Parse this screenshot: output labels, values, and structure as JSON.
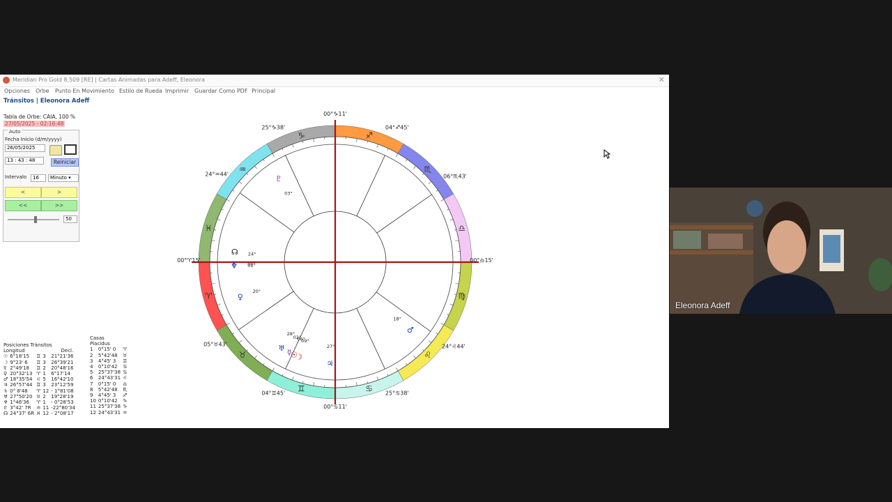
{
  "window": {
    "title": "Meridian Pro Gold 8.509 [RE] | Cartas Animadas para Adeff, Eleonora",
    "close_glyph": "✕"
  },
  "menu": [
    "Opciones",
    "Orbe",
    "Punto En Movimiento",
    "Estilo de Rueda",
    "Imprimir",
    "Guardar Como PDF",
    "Principal"
  ],
  "header": {
    "title": "Tránsitos | Eleonora Adeff",
    "orb_table": "Tabla de Orbe: CAIA, 100 %",
    "datetime": "27/05/2025 - 02:16:48"
  },
  "controls": {
    "auto_label": "Auto",
    "start_label": "Fecha Inicio (d/m/yyyy)",
    "start_date": "26/05/2025",
    "start_time": "13 : 43 : 48",
    "reset_label": "Reiniciar",
    "interval_label": "Intervalo",
    "interval_value": "16",
    "interval_unit": "Minuto",
    "prev_label": "<",
    "next_label": ">",
    "fast_prev_label": "<<",
    "fast_next_label": ">>",
    "slider_value": "50"
  },
  "positions": {
    "title": "Posiciones Tránsitos",
    "col_long": "Longitud",
    "col_decl": "Decl.",
    "rows": [
      {
        "glyph": "☉",
        "long": "6°18'15",
        "sign": "♊",
        "house": "3",
        "decl": "21°21'36"
      },
      {
        "glyph": "☽",
        "long": "9°23' 6",
        "sign": "♊",
        "house": "3",
        "decl": "26°39'21"
      },
      {
        "glyph": "☿",
        "long": "2°49'18",
        "sign": "♊",
        "house": "2",
        "decl": "20°48'16"
      },
      {
        "glyph": "♀",
        "long": "20°32'13",
        "sign": "♈",
        "house": "1",
        "decl": "6°17'14"
      },
      {
        "glyph": "♂",
        "long": "18°35'54",
        "sign": "♌",
        "house": "5",
        "decl": "16°42'10"
      },
      {
        "glyph": "♃",
        "long": "26°57'44",
        "sign": "♊",
        "house": "3",
        "decl": "23°12'59"
      },
      {
        "glyph": "♄",
        "long": "0° 8'48",
        "sign": "♈",
        "house": "12",
        "decl": "- 1°81'08"
      },
      {
        "glyph": "♅",
        "long": "27°50'20",
        "sign": "♉",
        "house": "2",
        "decl": "19°28'19"
      },
      {
        "glyph": "♆",
        "long": "1°46'36",
        "sign": "♈",
        "house": "1",
        "decl": "- 0°28'53"
      },
      {
        "glyph": "♇",
        "long": "3°42' 7R",
        "sign": "♒",
        "house": "11",
        "decl": "-22°80'34"
      },
      {
        "glyph": "☊",
        "long": "24°37' 6R",
        "sign": "♓",
        "house": "12",
        "decl": "- 2°08'17"
      }
    ]
  },
  "houses": {
    "title": "Casas",
    "subtitle": "Placidus",
    "rows": [
      {
        "n": "1",
        "pos": "0°15' 0",
        "sign": "♈"
      },
      {
        "n": "2",
        "pos": "5°42'48",
        "sign": "♉"
      },
      {
        "n": "3",
        "pos": "4°45' 3",
        "sign": "♊"
      },
      {
        "n": "4",
        "pos": "0°10'42",
        "sign": "♋"
      },
      {
        "n": "5",
        "pos": "25°37'38",
        "sign": "♋"
      },
      {
        "n": "6",
        "pos": "24°43'31",
        "sign": "♌"
      },
      {
        "n": "7",
        "pos": "0°15' 0",
        "sign": "♎"
      },
      {
        "n": "8",
        "pos": "5°42'48",
        "sign": "♏"
      },
      {
        "n": "9",
        "pos": "4°45' 3",
        "sign": "♐"
      },
      {
        "n": "10",
        "pos": "0°10'42",
        "sign": "♑"
      },
      {
        "n": "11",
        "pos": "25°37'38",
        "sign": "♑"
      },
      {
        "n": "12",
        "pos": "24°43'31",
        "sign": "♒"
      }
    ]
  },
  "wheel": {
    "signs": [
      {
        "glyph": "♈",
        "color": "#ff5252"
      },
      {
        "glyph": "♉",
        "color": "#7fae55"
      },
      {
        "glyph": "♊",
        "color": "#8ef0d8"
      },
      {
        "glyph": "♋",
        "color": "#c7f5ec"
      },
      {
        "glyph": "♌",
        "color": "#f5ea55"
      },
      {
        "glyph": "♍",
        "color": "#c5d44c"
      },
      {
        "glyph": "♎",
        "color": "#f4c8f4"
      },
      {
        "glyph": "♏",
        "color": "#8585ee"
      },
      {
        "glyph": "♐",
        "color": "#ff9a40"
      },
      {
        "glyph": "♑",
        "color": "#a9a9a9"
      },
      {
        "glyph": "♒",
        "color": "#7fe2ef"
      },
      {
        "glyph": "♓",
        "color": "#90b870"
      }
    ],
    "cusp_labels": [
      {
        "deg": "00°",
        "min": "15'",
        "glyph": "♈"
      },
      {
        "deg": "05°",
        "min": "43'",
        "glyph": "♉"
      },
      {
        "deg": "04°",
        "min": "45'",
        "glyph": "♊"
      },
      {
        "deg": "00°",
        "min": "11'",
        "glyph": "♋"
      },
      {
        "deg": "25°",
        "min": "38'",
        "glyph": "♋"
      },
      {
        "deg": "24°",
        "min": "44'",
        "glyph": "♌"
      },
      {
        "deg": "00°",
        "min": "15'",
        "glyph": "♎"
      },
      {
        "deg": "06°",
        "min": "43'",
        "glyph": "♏"
      },
      {
        "deg": "04°",
        "min": "45'",
        "glyph": "♐"
      },
      {
        "deg": "00°",
        "min": "11'",
        "glyph": "♑"
      },
      {
        "deg": "25°",
        "min": "38'",
        "glyph": "♑"
      },
      {
        "deg": "24°",
        "min": "44'",
        "glyph": "♒"
      }
    ],
    "planets": [
      {
        "glyph": "☉",
        "deg": "06°",
        "color": "#c00000"
      },
      {
        "glyph": "☽",
        "deg": "09°",
        "color": "#c00000"
      },
      {
        "glyph": "☿",
        "deg": "02°",
        "color": "#6a2fa0"
      },
      {
        "glyph": "♀",
        "deg": "20°",
        "color": "#1a3cb8"
      },
      {
        "glyph": "♂",
        "deg": "18°",
        "color": "#1a3cb8"
      },
      {
        "glyph": "♃",
        "deg": "27°",
        "color": "#1a3cb8"
      },
      {
        "glyph": "♄",
        "deg": "00°",
        "color": "#1a3cb8"
      },
      {
        "glyph": "♅",
        "deg": "28°",
        "color": "#1a3cb8"
      },
      {
        "glyph": "♆",
        "deg": "01°",
        "color": "#1a3cb8"
      },
      {
        "glyph": "♇",
        "deg": "03°",
        "color": "#a02fa0"
      },
      {
        "glyph": "☊",
        "deg": "24°",
        "color": "#111111"
      }
    ]
  },
  "video": {
    "name": "Eleonora Adeff"
  }
}
